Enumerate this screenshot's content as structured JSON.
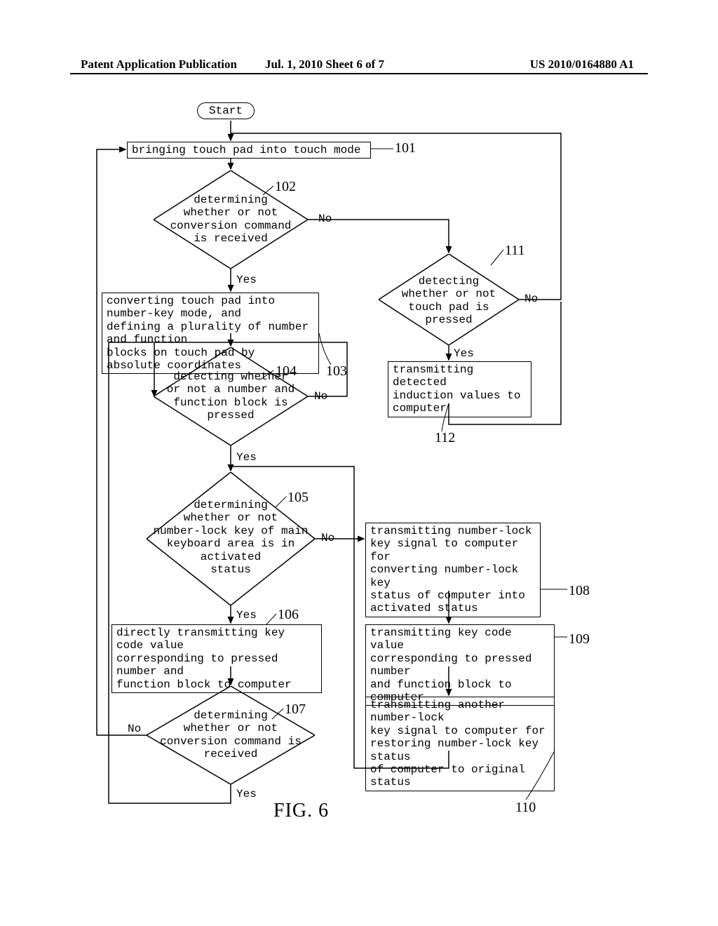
{
  "header": {
    "left": "Patent Application Publication",
    "center": "Jul. 1, 2010   Sheet 6 of 7",
    "right": "US 2010/0164880 A1"
  },
  "nodes": {
    "start": "Start",
    "s101": "bringing touch pad into touch mode",
    "s102": "determining\nwhether or not\nconversion command\nis received",
    "s103": "converting touch pad into number-key mode, and\ndefining a plurality of number and function\nblocks on touch pad by absolute coordinates",
    "s104": "detecting whether\nor not a number and\nfunction block is\npressed",
    "s105": "determining\nwhether or not\nnumber-lock key of main\nkeyboard area is in\nactivated\nstatus",
    "s106": "directly transmitting key code value\ncorresponding to pressed number and\nfunction block to computer",
    "s107": "determining\nwhether or not\nconversion command is\nreceived",
    "s108": "transmitting number-lock\nkey signal to computer for\nconverting number-lock key\nstatus of computer into\nactivated status",
    "s109": "transmitting key code value\ncorresponding to pressed number\nand function block to computer",
    "s110": "transmitting another number-lock\nkey signal to computer for\nrestoring number-lock key status\nof computer to original status",
    "s111": "detecting\nwhether or not\ntouch pad is\npressed",
    "s112": "transmitting detected\ninduction values to\ncomputer"
  },
  "edges": {
    "yes": "Yes",
    "no": "No"
  },
  "refs": {
    "r101": "101",
    "r102": "102",
    "r103": "103",
    "r104": "104",
    "r105": "105",
    "r106": "106",
    "r107": "107",
    "r108": "108",
    "r109": "109",
    "r110": "110",
    "r111": "111",
    "r112": "112"
  },
  "figure": "FIG. 6"
}
